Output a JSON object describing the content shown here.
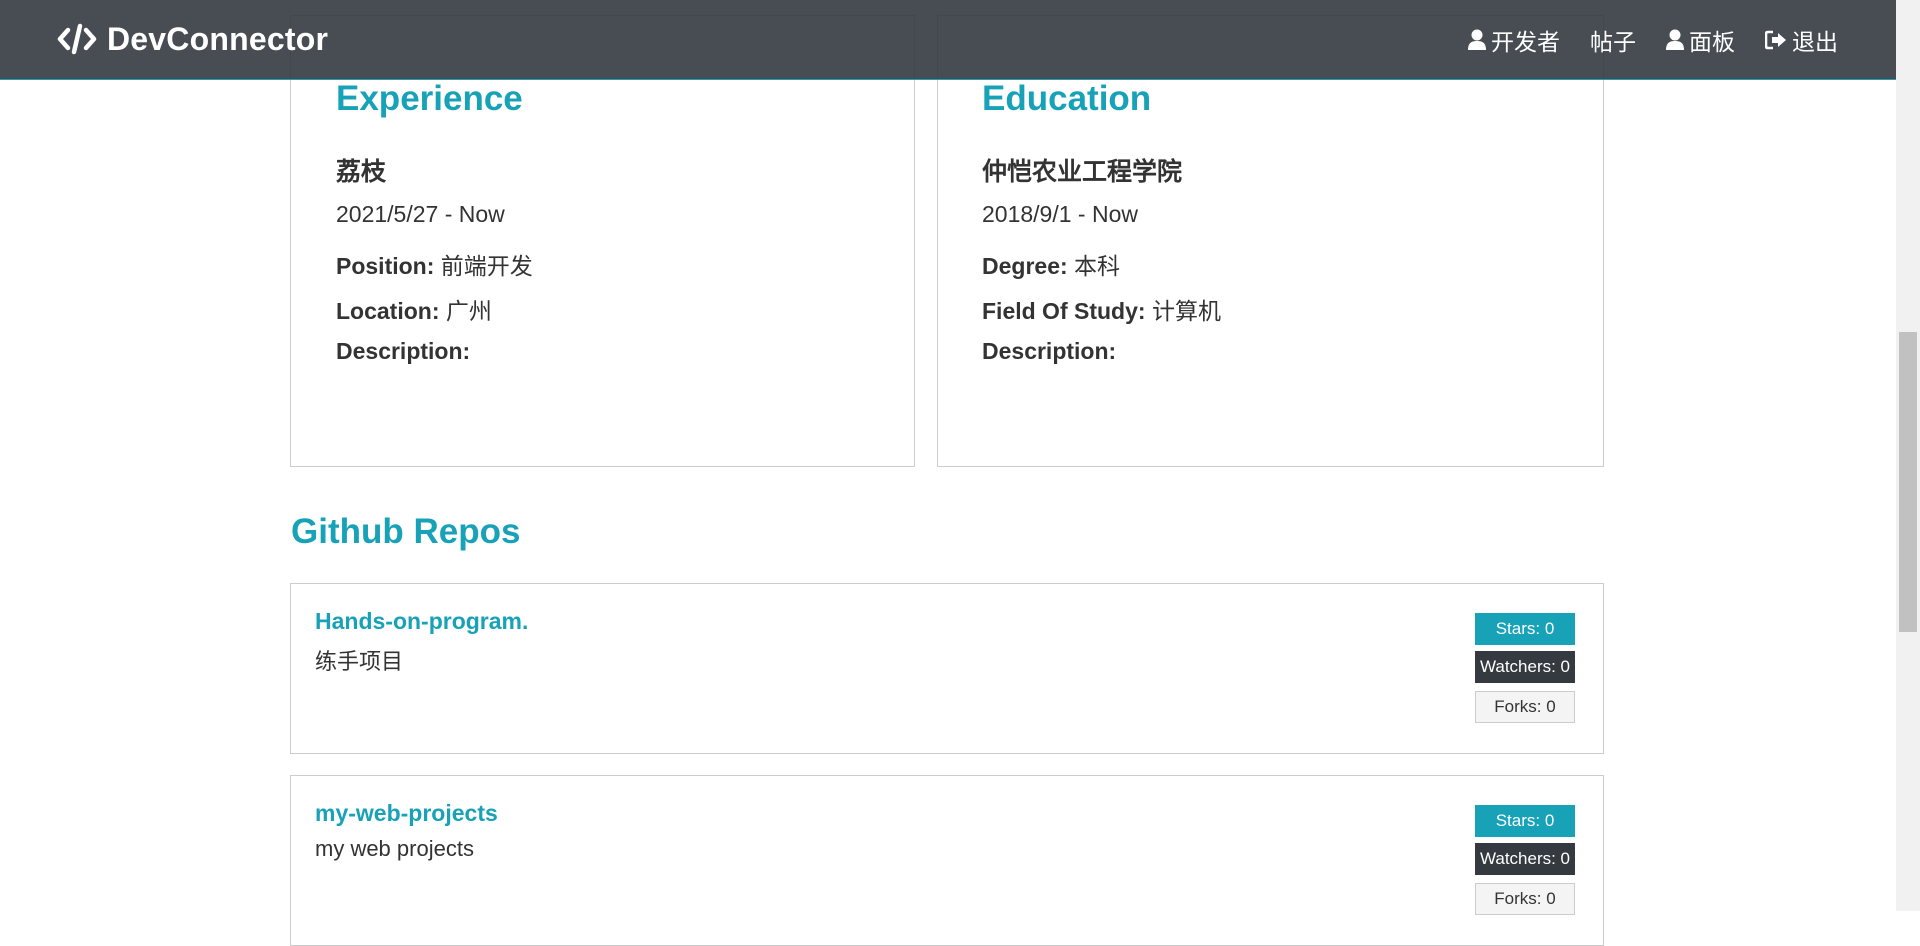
{
  "nav": {
    "brand": "DevConnector",
    "links": [
      {
        "label": "开发者",
        "icon": "user-icon"
      },
      {
        "label": "帖子"
      },
      {
        "label": "面板",
        "icon": "user-icon"
      },
      {
        "label": "退出",
        "icon": "sign-out-icon"
      }
    ]
  },
  "experience": {
    "title": "Experience",
    "company": "荔枝",
    "dates": "2021/5/27 - Now",
    "position_label": "Position:",
    "position": "前端开发",
    "location_label": "Location:",
    "location": "广州",
    "description_label": "Description:"
  },
  "education": {
    "title": "Education",
    "school": "仲恺农业工程学院",
    "dates": "2018/9/1 - Now",
    "degree_label": "Degree:",
    "degree": "本科",
    "field_label": "Field Of Study:",
    "field": "计算机",
    "description_label": "Description:"
  },
  "github": {
    "title": "Github Repos",
    "repos": [
      {
        "name": "Hands-on-program.",
        "description": "练手项目",
        "stars": "Stars: 0",
        "watchers": "Watchers: 0",
        "forks": "Forks: 0"
      },
      {
        "name": "my-web-projects",
        "description": "my web projects",
        "stars": "Stars: 0",
        "watchers": "Watchers: 0",
        "forks": "Forks: 0"
      }
    ]
  },
  "colors": {
    "primary": "#17a2b8",
    "dark": "#343a40",
    "light": "#f4f4f4",
    "text": "#333333"
  }
}
